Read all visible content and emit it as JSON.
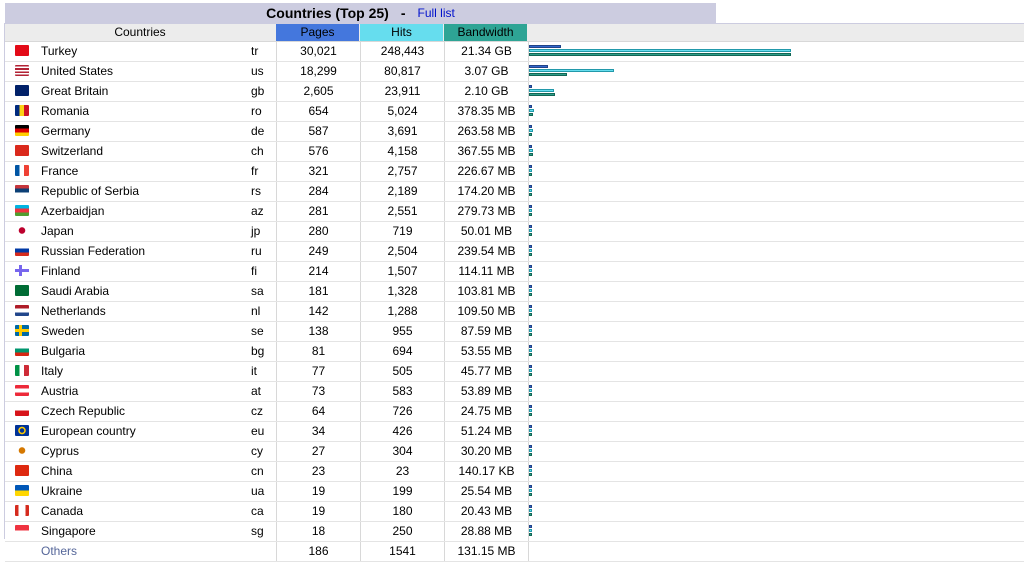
{
  "title": "Countries (Top 25)",
  "title_sep": "-",
  "full_list_label": "Full list",
  "headers": {
    "countries": "Countries",
    "pages": "Pages",
    "hits": "Hits",
    "bandwidth": "Bandwidth"
  },
  "colors": {
    "pages": "#4477dd",
    "hits": "#66ddee",
    "bandwidth": "#2ea495"
  },
  "rows": [
    {
      "name": "Turkey",
      "code": "tr",
      "pages": "30,021",
      "hits": "248,443",
      "bandwidth": "21.34 GB",
      "flag": "turkey-flag-icon",
      "pf": 0.121,
      "hf": 1.0,
      "bf": 1.0
    },
    {
      "name": "United States",
      "code": "us",
      "pages": "18,299",
      "hits": "80,817",
      "bandwidth": "3.07 GB",
      "flag": "us-flag-icon",
      "pf": 0.074,
      "hf": 0.325,
      "bf": 0.144
    },
    {
      "name": "Great Britain",
      "code": "gb",
      "pages": "2,605",
      "hits": "23,911",
      "bandwidth": "2.10 GB",
      "flag": "gb-flag-icon",
      "pf": 0.01,
      "hf": 0.096,
      "bf": 0.098
    },
    {
      "name": "Romania",
      "code": "ro",
      "pages": "654",
      "hits": "5,024",
      "bandwidth": "378.35 MB",
      "flag": "romania-flag-icon",
      "pf": 0.003,
      "hf": 0.02,
      "bf": 0.017
    },
    {
      "name": "Germany",
      "code": "de",
      "pages": "587",
      "hits": "3,691",
      "bandwidth": "263.58 MB",
      "flag": "germany-flag-icon",
      "pf": 0.002,
      "hf": 0.015,
      "bf": 0.012
    },
    {
      "name": "Switzerland",
      "code": "ch",
      "pages": "576",
      "hits": "4,158",
      "bandwidth": "367.55 MB",
      "flag": "switzerland-flag-icon",
      "pf": 0.002,
      "hf": 0.017,
      "bf": 0.017
    },
    {
      "name": "France",
      "code": "fr",
      "pages": "321",
      "hits": "2,757",
      "bandwidth": "226.67 MB",
      "flag": "france-flag-icon",
      "pf": 0.001,
      "hf": 0.011,
      "bf": 0.01
    },
    {
      "name": "Republic of Serbia",
      "code": "rs",
      "pages": "284",
      "hits": "2,189",
      "bandwidth": "174.20 MB",
      "flag": "serbia-flag-icon",
      "pf": 0.001,
      "hf": 0.009,
      "bf": 0.008
    },
    {
      "name": "Azerbaidjan",
      "code": "az",
      "pages": "281",
      "hits": "2,551",
      "bandwidth": "279.73 MB",
      "flag": "azerbaijan-flag-icon",
      "pf": 0.001,
      "hf": 0.01,
      "bf": 0.013
    },
    {
      "name": "Japan",
      "code": "jp",
      "pages": "280",
      "hits": "719",
      "bandwidth": "50.01 MB",
      "flag": "japan-flag-icon",
      "pf": 0.001,
      "hf": 0.003,
      "bf": 0.002
    },
    {
      "name": "Russian Federation",
      "code": "ru",
      "pages": "249",
      "hits": "2,504",
      "bandwidth": "239.54 MB",
      "flag": "russia-flag-icon",
      "pf": 0.001,
      "hf": 0.01,
      "bf": 0.011
    },
    {
      "name": "Finland",
      "code": "fi",
      "pages": "214",
      "hits": "1,507",
      "bandwidth": "114.11 MB",
      "flag": "finland-flag-icon",
      "pf": 0.001,
      "hf": 0.006,
      "bf": 0.005
    },
    {
      "name": "Saudi Arabia",
      "code": "sa",
      "pages": "181",
      "hits": "1,328",
      "bandwidth": "103.81 MB",
      "flag": "saudi-arabia-flag-icon",
      "pf": 0.001,
      "hf": 0.005,
      "bf": 0.005
    },
    {
      "name": "Netherlands",
      "code": "nl",
      "pages": "142",
      "hits": "1,288",
      "bandwidth": "109.50 MB",
      "flag": "netherlands-flag-icon",
      "pf": 0.001,
      "hf": 0.005,
      "bf": 0.005
    },
    {
      "name": "Sweden",
      "code": "se",
      "pages": "138",
      "hits": "955",
      "bandwidth": "87.59 MB",
      "flag": "sweden-flag-icon",
      "pf": 0.001,
      "hf": 0.004,
      "bf": 0.004
    },
    {
      "name": "Bulgaria",
      "code": "bg",
      "pages": "81",
      "hits": "694",
      "bandwidth": "53.55 MB",
      "flag": "bulgaria-flag-icon",
      "pf": 0.001,
      "hf": 0.003,
      "bf": 0.002
    },
    {
      "name": "Italy",
      "code": "it",
      "pages": "77",
      "hits": "505",
      "bandwidth": "45.77 MB",
      "flag": "italy-flag-icon",
      "pf": 0.001,
      "hf": 0.002,
      "bf": 0.002
    },
    {
      "name": "Austria",
      "code": "at",
      "pages": "73",
      "hits": "583",
      "bandwidth": "53.89 MB",
      "flag": "austria-flag-icon",
      "pf": 0.001,
      "hf": 0.002,
      "bf": 0.002
    },
    {
      "name": "Czech Republic",
      "code": "cz",
      "pages": "64",
      "hits": "726",
      "bandwidth": "24.75 MB",
      "flag": "czech-flag-icon",
      "pf": 0.001,
      "hf": 0.003,
      "bf": 0.001
    },
    {
      "name": "European country",
      "code": "eu",
      "pages": "34",
      "hits": "426",
      "bandwidth": "51.24 MB",
      "flag": "eu-flag-icon",
      "pf": 0.001,
      "hf": 0.002,
      "bf": 0.002
    },
    {
      "name": "Cyprus",
      "code": "cy",
      "pages": "27",
      "hits": "304",
      "bandwidth": "30.20 MB",
      "flag": "cyprus-flag-icon",
      "pf": 0.001,
      "hf": 0.001,
      "bf": 0.001
    },
    {
      "name": "China",
      "code": "cn",
      "pages": "23",
      "hits": "23",
      "bandwidth": "140.17 KB",
      "flag": "china-flag-icon",
      "pf": 0.001,
      "hf": 0.001,
      "bf": 0.001
    },
    {
      "name": "Ukraine",
      "code": "ua",
      "pages": "19",
      "hits": "199",
      "bandwidth": "25.54 MB",
      "flag": "ukraine-flag-icon",
      "pf": 0.001,
      "hf": 0.001,
      "bf": 0.001
    },
    {
      "name": "Canada",
      "code": "ca",
      "pages": "19",
      "hits": "180",
      "bandwidth": "20.43 MB",
      "flag": "canada-flag-icon",
      "pf": 0.001,
      "hf": 0.001,
      "bf": 0.001
    },
    {
      "name": "Singapore",
      "code": "sg",
      "pages": "18",
      "hits": "250",
      "bandwidth": "28.88 MB",
      "flag": "singapore-flag-icon",
      "pf": 0.001,
      "hf": 0.001,
      "bf": 0.001
    }
  ],
  "others": {
    "name": "Others",
    "pages": "186",
    "hits": "1541",
    "bandwidth": "131.15 MB"
  }
}
